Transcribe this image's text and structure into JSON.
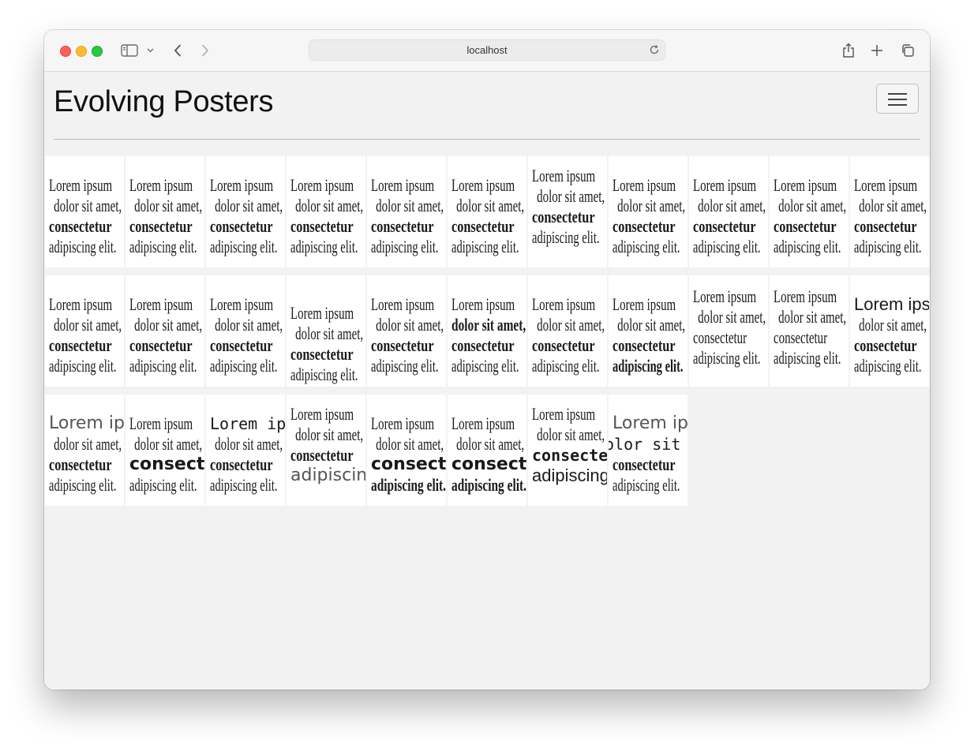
{
  "browser": {
    "url": "localhost"
  },
  "page": {
    "title": "Evolving Posters"
  },
  "poster_text": {
    "line1": "Lorem ipsum",
    "line2": "dolor sit amet,",
    "line3": "consectetur",
    "line4": "adipiscing elit."
  }
}
